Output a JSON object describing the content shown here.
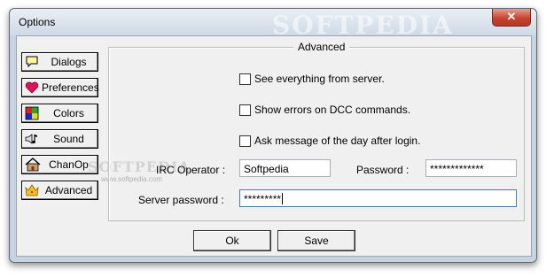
{
  "window": {
    "title": "Options",
    "watermark": "SOFTPEDIA",
    "close_glyph": "✕"
  },
  "sidebar": {
    "items": [
      {
        "label": "Dialogs",
        "icon": "speech-bubble-icon"
      },
      {
        "label": "Preferences",
        "icon": "heart-icon"
      },
      {
        "label": "Colors",
        "icon": "palette-icon"
      },
      {
        "label": "Sound",
        "icon": "speaker-note-icon"
      },
      {
        "label": "ChanOp",
        "icon": "house-icon"
      },
      {
        "label": "Advanced",
        "icon": "crown-icon"
      }
    ]
  },
  "advanced": {
    "legend": "Advanced",
    "checkboxes": [
      {
        "label": "See everything from server.",
        "checked": false
      },
      {
        "label": "Show errors on DCC commands.",
        "checked": false
      },
      {
        "label": "Ask message of the day after login.",
        "checked": false
      }
    ],
    "irc_operator_label": "IRC Operator :",
    "irc_operator_value": "Softpedia",
    "password_label": "Password :",
    "password_value": "*************",
    "server_password_label": "Server password :",
    "server_password_value": "*********"
  },
  "buttons": {
    "ok": "Ok",
    "save": "Save"
  },
  "watermark_mid": "SOFTPEDIA",
  "watermark_url": "www.softpedia.com"
}
